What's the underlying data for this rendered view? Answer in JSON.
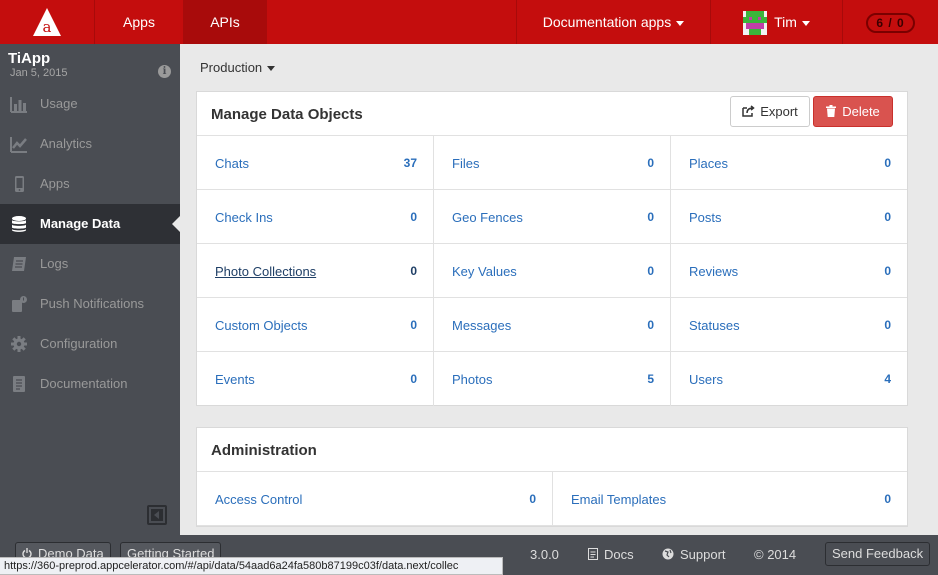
{
  "topbar": {
    "apps_label": "Apps",
    "apis_label": "APIs",
    "doc_apps_label": "Documentation apps",
    "user_name": "Tim",
    "count_badge": "6 / 0"
  },
  "sidebar": {
    "app_name": "TiApp",
    "app_date": "Jan 5, 2015",
    "items": [
      {
        "label": "Usage",
        "icon": "bar-chart-icon"
      },
      {
        "label": "Analytics",
        "icon": "line-chart-icon"
      },
      {
        "label": "Apps",
        "icon": "phone-icon"
      },
      {
        "label": "Manage Data",
        "icon": "database-icon",
        "active": true
      },
      {
        "label": "Logs",
        "icon": "logs-icon"
      },
      {
        "label": "Push Notifications",
        "icon": "push-icon"
      },
      {
        "label": "Configuration",
        "icon": "gear-icon"
      },
      {
        "label": "Documentation",
        "icon": "document-icon"
      }
    ]
  },
  "main": {
    "environment": "Production",
    "data_panel": {
      "title": "Manage Data Objects",
      "export_label": "Export",
      "delete_label": "Delete",
      "rows": [
        [
          {
            "label": "Chats",
            "count": "37"
          },
          {
            "label": "Files",
            "count": "0"
          },
          {
            "label": "Places",
            "count": "0"
          }
        ],
        [
          {
            "label": "Check Ins",
            "count": "0"
          },
          {
            "label": "Geo Fences",
            "count": "0"
          },
          {
            "label": "Posts",
            "count": "0"
          }
        ],
        [
          {
            "label": "Photo Collections",
            "count": "0"
          },
          {
            "label": "Key Values",
            "count": "0"
          },
          {
            "label": "Reviews",
            "count": "0"
          }
        ],
        [
          {
            "label": "Custom Objects",
            "count": "0"
          },
          {
            "label": "Messages",
            "count": "0"
          },
          {
            "label": "Statuses",
            "count": "0"
          }
        ],
        [
          {
            "label": "Events",
            "count": "0"
          },
          {
            "label": "Photos",
            "count": "5"
          },
          {
            "label": "Users",
            "count": "4"
          }
        ]
      ]
    },
    "admin_panel": {
      "title": "Administration",
      "items": [
        {
          "label": "Access Control",
          "count": "0"
        },
        {
          "label": "Email Templates",
          "count": "0"
        }
      ]
    }
  },
  "footer": {
    "demo_data_label": "Demo Data",
    "getting_started_label": "Getting Started",
    "version": "3.0.0",
    "docs_label": "Docs",
    "support_label": "Support",
    "copyright": "© 2014",
    "send_feedback_label": "Send Feedback"
  },
  "status_url": "https://360-preprod.appcelerator.com/#/api/data/54aad6a24fa580b87199c03f/data.next/collec",
  "colors": {
    "brand_red": "#c40d0d",
    "sidebar_bg": "#4a4d53",
    "link_blue": "#2a6ebb",
    "delete_red": "#d9534f"
  }
}
